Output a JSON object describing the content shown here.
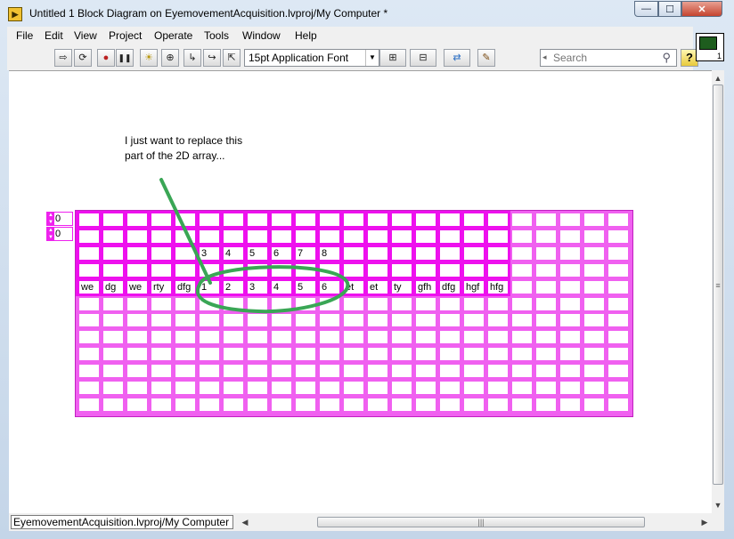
{
  "window": {
    "title": "Untitled 1 Block Diagram on EyemovementAcquisition.lvproj/My Computer *",
    "min_glyph": "—",
    "max_glyph": "☐",
    "close_glyph": "✕",
    "app_icon_glyph": "▶"
  },
  "menu": {
    "items": [
      "File",
      "Edit",
      "View",
      "Project",
      "Operate",
      "Tools",
      "Window",
      "Help"
    ]
  },
  "toolbar": {
    "buttons": [
      {
        "name": "run-arrow-icon",
        "glyph": "⇨"
      },
      {
        "name": "run-continuously-icon",
        "glyph": "⟳"
      },
      {
        "name": "abort-icon",
        "glyph": "●"
      },
      {
        "name": "pause-icon",
        "glyph": "❚❚"
      },
      {
        "name": "highlight-execution-icon",
        "glyph": "☀"
      },
      {
        "name": "retain-wire-values-icon",
        "glyph": "⊕"
      },
      {
        "name": "step-into-icon",
        "glyph": "↳"
      },
      {
        "name": "step-over-icon",
        "glyph": "↪"
      },
      {
        "name": "step-out-icon",
        "glyph": "⇱"
      }
    ],
    "font_label": "15pt Application Font",
    "align_glyph": "⊞",
    "distribute_glyph": "⊟",
    "reorder_glyph": "⇄",
    "cleanup_glyph": "✎",
    "search_placeholder": "Search",
    "search_icon": "magnifier-icon",
    "help_label": "?"
  },
  "vi_icon": {
    "number": "1"
  },
  "annotation": {
    "line1": "I just want to replace this",
    "line2": "part of the 2D array..."
  },
  "array": {
    "index_row": "0",
    "index_col": "0",
    "rows": [
      [
        "",
        "",
        "",
        "",
        "",
        "",
        "",
        "",
        "",
        "",
        "",
        "",
        "",
        "",
        "",
        "",
        ""
      ],
      [
        "",
        "",
        "",
        "",
        "",
        "",
        "",
        "",
        "",
        "",
        "",
        "",
        "",
        "",
        "",
        "",
        ""
      ],
      [
        "",
        "",
        "",
        "",
        "",
        "3",
        "4",
        "5",
        "6",
        "7",
        "8",
        "",
        "",
        "",
        "",
        "",
        ""
      ],
      [
        "",
        "",
        "",
        "",
        "",
        "",
        "",
        "",
        "",
        "",
        "",
        "",
        "",
        "",
        "",
        "",
        ""
      ],
      [
        "we",
        "dg",
        "we",
        "rty",
        "dfg",
        "1",
        "2",
        "3",
        "4",
        "5",
        "6",
        "et",
        "et",
        "ty",
        "gfh",
        "dfg",
        "hgf",
        "hfg"
      ]
    ]
  },
  "status": {
    "path": "EyemovementAcquisition.lvproj/My Computer",
    "scroll_left": "◀",
    "scroll_right": "▶",
    "scroll_up": "▲",
    "scroll_down": "▼",
    "grip": "|||"
  },
  "colors": {
    "array_frame": "#f060f0",
    "array_active": "#ee10ee",
    "annotation_pen": "#3aa655"
  }
}
